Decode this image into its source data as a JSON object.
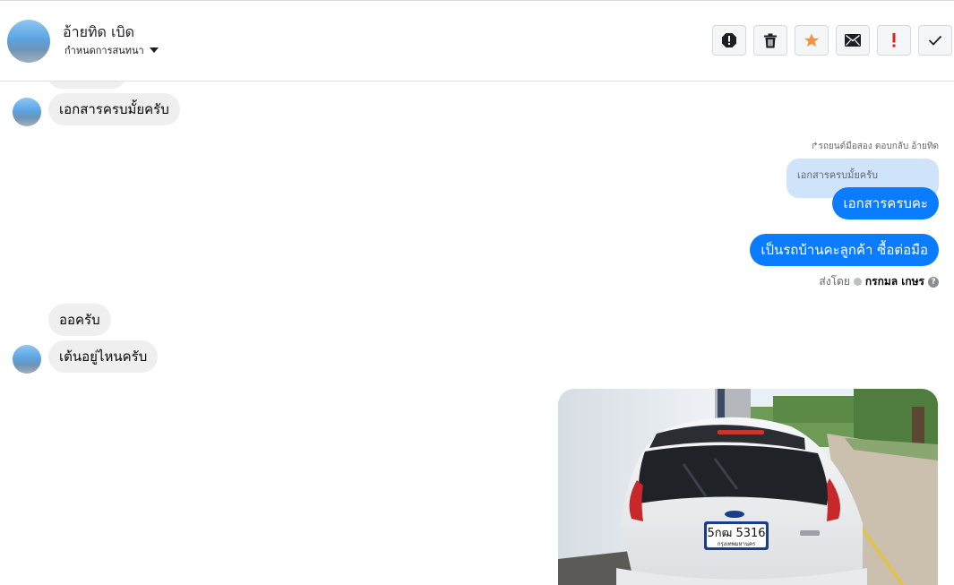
{
  "contact": {
    "name": "อ้ายทิด เบิด",
    "assign_label": "กำหนดการสนทนา"
  },
  "actions": [
    {
      "name": "report-spam-icon"
    },
    {
      "name": "trash-icon"
    },
    {
      "name": "star-icon"
    },
    {
      "name": "envelope-icon"
    },
    {
      "name": "exclamation-icon"
    },
    {
      "name": "check-icon"
    }
  ],
  "messages": {
    "in_1": "เอกสารครบมั้ยครับ",
    "reply_header": "รถยนต์มือสอง ตอบกลับ อ้ายทิด",
    "quoted": "เอกสารครบมั้ยครับ",
    "out_1": "เอกสารครบคะ",
    "out_2": "เป็นรถบ้านคะลูกค้า ซื้อต่อมือ",
    "sent_by_prefix": "ส่งโดย",
    "sent_by_name": "กรกมล เกษร",
    "in_2": "ออครับ",
    "in_3": "เต้นอยู่ไหนครับ"
  },
  "photo": {
    "plate_number": "5กฒ 5316",
    "plate_province": "กรุงเทพมหานคร"
  },
  "colors": {
    "outgoing_bubble": "#0a7cff",
    "incoming_bubble": "#efefef",
    "quoted_bubble": "#cfe3fb",
    "star": "#f7923a",
    "exclamation": "#e02020"
  }
}
